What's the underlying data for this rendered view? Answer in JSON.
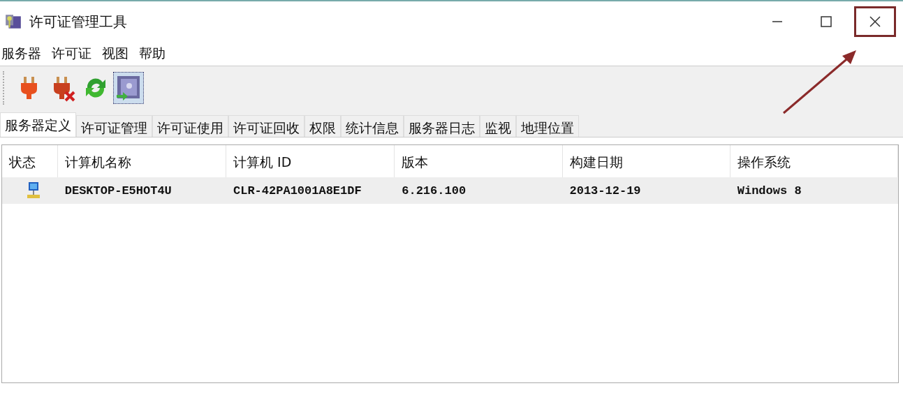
{
  "window": {
    "title": "许可证管理工具",
    "close_highlighted": true
  },
  "menu": [
    "服务器",
    "许可证",
    "视图",
    "帮助"
  ],
  "toolbar": [
    {
      "kind": "plug",
      "focused": false
    },
    {
      "kind": "plug-off",
      "focused": false
    },
    {
      "kind": "refresh",
      "focused": false
    },
    {
      "kind": "import",
      "focused": true
    }
  ],
  "tabs": [
    {
      "label": "服务器定义",
      "selected": true
    },
    {
      "label": "许可证管理",
      "selected": false
    },
    {
      "label": "许可证使用",
      "selected": false
    },
    {
      "label": "许可证回收",
      "selected": false
    },
    {
      "label": "权限",
      "selected": false
    },
    {
      "label": "统计信息",
      "selected": false
    },
    {
      "label": "服务器日志",
      "selected": false
    },
    {
      "label": "监视",
      "selected": false
    },
    {
      "label": "地理位置",
      "selected": false
    }
  ],
  "table": {
    "columns": [
      "状态",
      "计算机名称",
      "计算机 ID",
      "版本",
      "构建日期",
      "操作系统"
    ],
    "rows": [
      {
        "kind": "computer",
        "selected": true,
        "cells": [
          "",
          "DESKTOP-E5HOT4U",
          "CLR-42PA1001A8E1DF",
          "6.216.100",
          "2013-12-19",
          "Windows 8"
        ]
      }
    ]
  },
  "annotations": [
    {
      "kind": "arrow"
    }
  ]
}
